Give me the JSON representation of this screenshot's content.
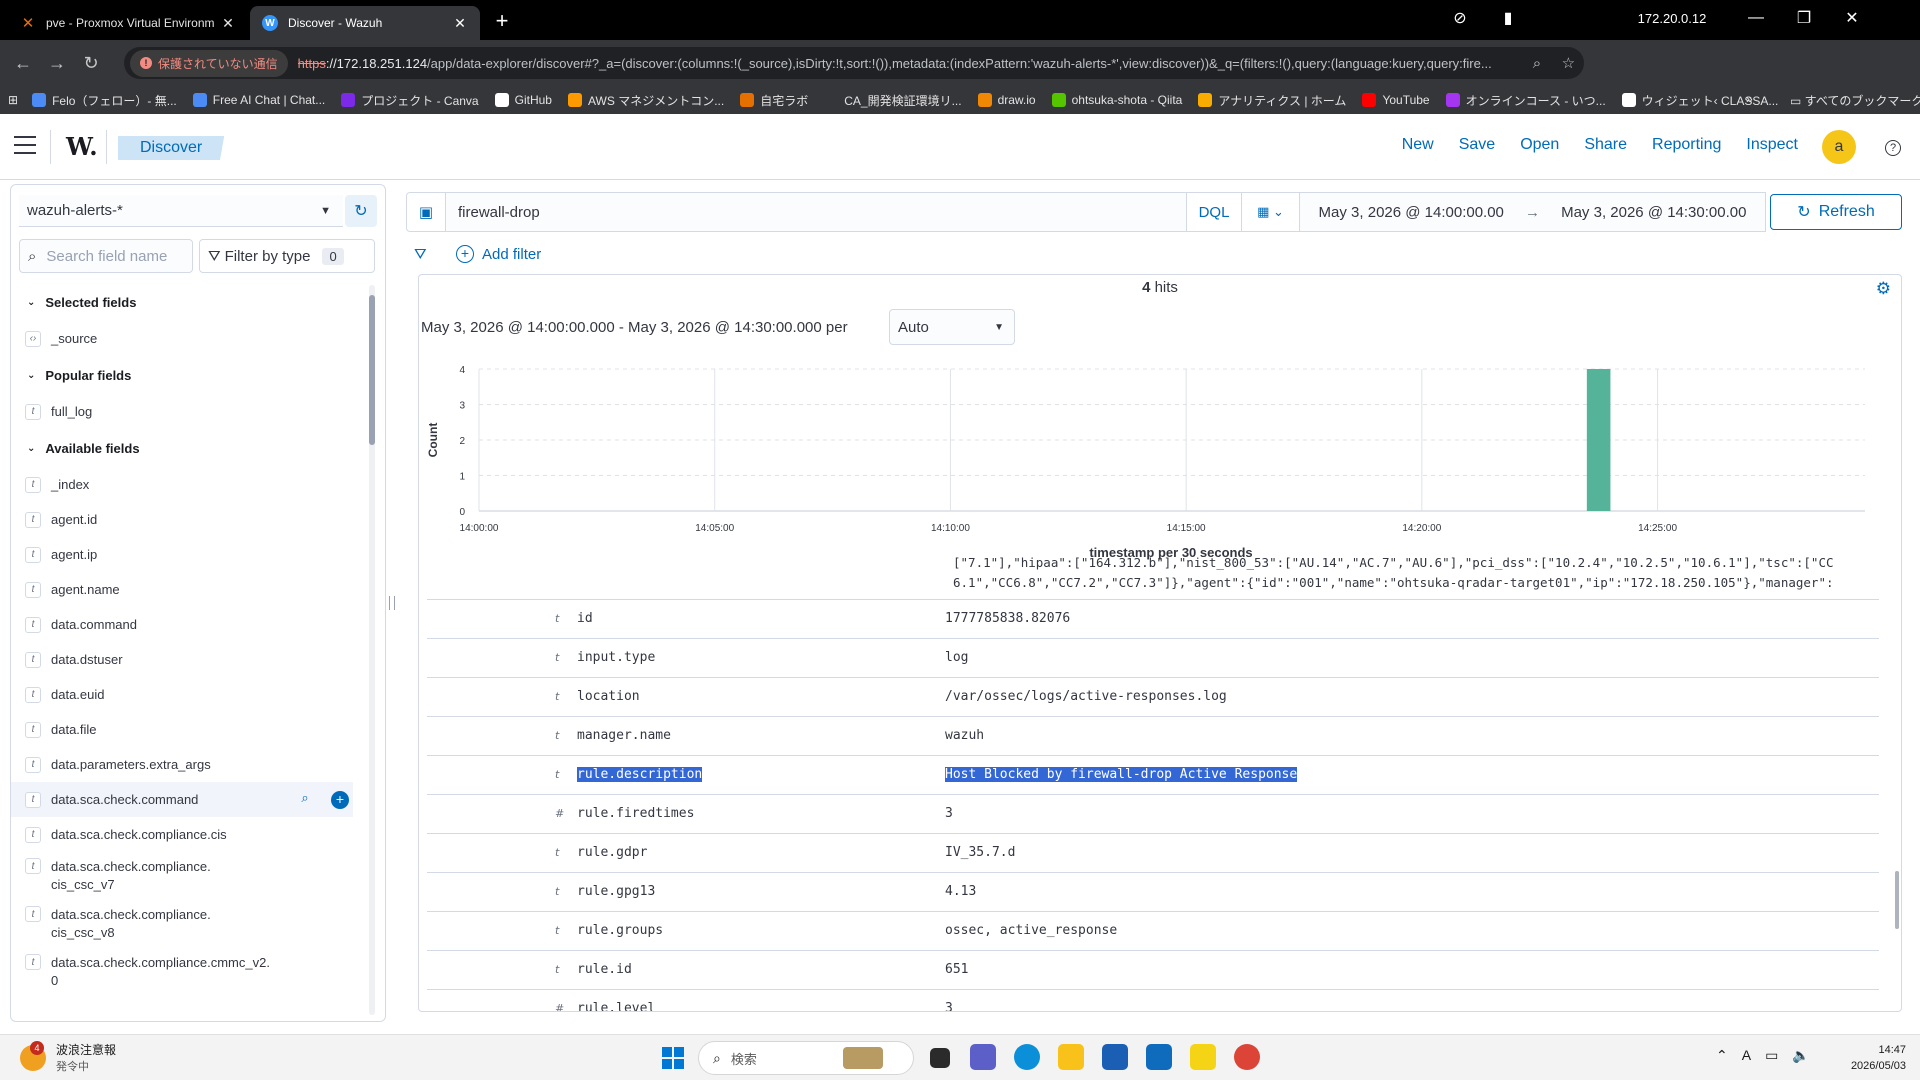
{
  "browser": {
    "tabs": [
      {
        "title": "pve - Proxmox Virtual Environm",
        "active": false
      },
      {
        "title": "Discover - Wazuh",
        "active": true
      }
    ],
    "status_ip": "172.20.0.12",
    "insecure_label": "保護されていない通信",
    "url_proto": "https",
    "url_host": "://172.18.251.124",
    "url_rest": "/app/data-explorer/discover#?_a=(discover:(columns:!(_source),isDirty:!t,sort:!()),metadata:(indexPattern:'wazuh-alerts-*',view:discover))&_q=(filters:!(),query:(language:kuery,query:fire...",
    "bookmarks": [
      {
        "label": "Felo（フェロー）- 無...",
        "color": "#4c8bf5"
      },
      {
        "label": "Free AI Chat | Chat...",
        "color": "#4c8bf5"
      },
      {
        "label": "プロジェクト - Canva",
        "color": "#7d2ae8"
      },
      {
        "label": "GitHub",
        "color": "#ffffff"
      },
      {
        "label": "AWS マネジメントコン...",
        "color": "#ff9900"
      },
      {
        "label": "自宅ラボ",
        "color": "#e57000"
      },
      {
        "label": "CA_開発検証環境リ...",
        "color": "#35363a"
      },
      {
        "label": "draw.io",
        "color": "#f08705"
      },
      {
        "label": "ohtsuka-shota - Qiita",
        "color": "#55c500"
      },
      {
        "label": "アナリティクス | ホーム",
        "color": "#f9ab00"
      },
      {
        "label": "YouTube",
        "color": "#ff0000"
      },
      {
        "label": "オンラインコース - いつ...",
        "color": "#a435f0"
      },
      {
        "label": "ウィジェット‹ CLASSA...",
        "color": "#ffffff"
      }
    ],
    "bookmarks_more": "»",
    "all_bookmarks": "すべてのブックマーク"
  },
  "header": {
    "logo": "W.",
    "breadcrumb": "Discover",
    "nav": [
      "New",
      "Save",
      "Open",
      "Share",
      "Reporting",
      "Inspect"
    ],
    "user_initial": "a"
  },
  "sidebar": {
    "index_pattern": "wazuh-alerts-*",
    "search_placeholder": "Search field name",
    "filter_by_type": "Filter by type",
    "filter_count": "0",
    "selected_title": "Selected fields",
    "selected": [
      {
        "name": "_source",
        "type": "src"
      }
    ],
    "popular_title": "Popular fields",
    "popular": [
      {
        "name": "full_log",
        "type": "t"
      }
    ],
    "available_title": "Available fields",
    "available": [
      {
        "name": "_index",
        "type": "t"
      },
      {
        "name": "agent.id",
        "type": "t"
      },
      {
        "name": "agent.ip",
        "type": "t"
      },
      {
        "name": "agent.name",
        "type": "t"
      },
      {
        "name": "data.command",
        "type": "t"
      },
      {
        "name": "data.dstuser",
        "type": "t"
      },
      {
        "name": "data.euid",
        "type": "t"
      },
      {
        "name": "data.file",
        "type": "t"
      },
      {
        "name": "data.parameters.extra_args",
        "type": "t"
      },
      {
        "name": "data.sca.check.command",
        "type": "t"
      },
      {
        "name": "data.sca.check.compliance.cis",
        "type": "t"
      },
      {
        "name": "data.sca.check.compliance.\ncis_csc_v7",
        "type": "t"
      },
      {
        "name": "data.sca.check.compliance.\ncis_csc_v8",
        "type": "t"
      },
      {
        "name": "data.sca.check.compliance.cmmc_v2.\n0",
        "type": "t"
      }
    ]
  },
  "query": {
    "text": "firewall-drop",
    "language": "DQL",
    "start": "May 3, 2026 @ 14:00:00.00",
    "end": "May 3, 2026 @ 14:30:00.00",
    "refresh": "Refresh",
    "add_filter": "Add filter"
  },
  "results": {
    "hits_count": "4",
    "hits_label": "hits",
    "interval_text": "May 3, 2026 @ 14:00:00.000 - May 3, 2026 @ 14:30:00.000 per",
    "interval_value": "Auto"
  },
  "chart_data": {
    "type": "bar",
    "xlabel": "timestamp per 30 seconds",
    "ylabel": "Count",
    "ylim": [
      0,
      4
    ],
    "yticks": [
      "0",
      "1",
      "2",
      "3",
      "4"
    ],
    "xticks": [
      "14:00:00",
      "14:05:00",
      "14:10:00",
      "14:15:00",
      "14:20:00",
      "14:25:00"
    ],
    "xrange_minutes": [
      0,
      30
    ],
    "bars": [
      {
        "x_minutes": 23.5,
        "value": 4
      }
    ],
    "bar_color": "#54b399",
    "grid": true
  },
  "document": {
    "overflow_lines": [
      "[\"7.1\"],\"hipaa\":[\"164.312.b\"],\"nist_800_53\":[\"AU.14\",\"AC.7\",\"AU.6\"],\"pci_dss\":[\"10.2.4\",\"10.2.5\",\"10.6.1\"],\"tsc\":[\"CC",
      "6.1\",\"CC6.8\",\"CC7.2\",\"CC7.3\"]},\"agent\":{\"id\":\"001\",\"name\":\"ohtsuka-qradar-target01\",\"ip\":\"172.18.250.105\"},\"manager\":"
    ],
    "rows": [
      {
        "type": "t",
        "key": "id",
        "value": "1777785838.82076"
      },
      {
        "type": "t",
        "key": "input.type",
        "value": "log"
      },
      {
        "type": "t",
        "key": "location",
        "value": "/var/ossec/logs/active-responses.log"
      },
      {
        "type": "t",
        "key": "manager.name",
        "value": "wazuh"
      },
      {
        "type": "t",
        "key": "rule.description",
        "value": "Host Blocked by firewall-drop Active Response",
        "highlight": true
      },
      {
        "type": "#",
        "key": "rule.firedtimes",
        "value": "3"
      },
      {
        "type": "t",
        "key": "rule.gdpr",
        "value": "IV_35.7.d"
      },
      {
        "type": "t",
        "key": "rule.gpg13",
        "value": "4.13"
      },
      {
        "type": "t",
        "key": "rule.groups",
        "value": "ossec, active_response"
      },
      {
        "type": "t",
        "key": "rule.id",
        "value": "651"
      },
      {
        "type": "#",
        "key": "rule.level",
        "value": "3"
      }
    ]
  },
  "taskbar": {
    "weather_title": "波浪注意報",
    "weather_sub": "発令中",
    "weather_badge": "4",
    "search_label": "検索",
    "time": "14:47",
    "date": "2026/05/03"
  }
}
